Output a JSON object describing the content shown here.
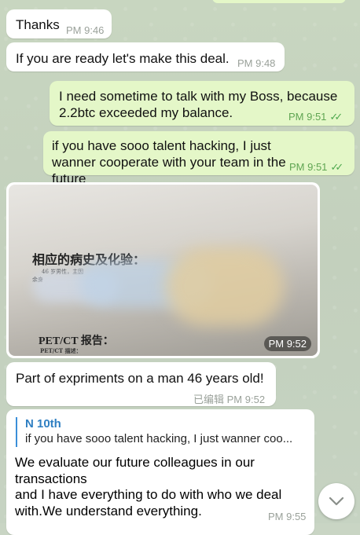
{
  "messages": {
    "m1": {
      "text": "Thanks",
      "time": "PM 9:46"
    },
    "m2": {
      "text": "If you are ready let's make this deal.",
      "time": "PM 9:48"
    },
    "m3": {
      "text": "I need sometime to talk with my Boss, because 2.2btc exceeded my balance.",
      "time": "PM 9:51",
      "status": "read"
    },
    "m4": {
      "text": "if you have sooo talent hacking, I just wanner cooperate with your team in the future",
      "time": "PM 9:51",
      "status": "read"
    },
    "photo": {
      "time": "PM 9:52",
      "heading": "相应的病史及化验：",
      "line1": "46 岁男性，主因",
      "line2": "余身",
      "subheading": "PET/CT 报告：",
      "sublabel": "PET/CT 描述："
    },
    "m5": {
      "text": "Part of expriments on a man 46 years old!",
      "edited": "已编辑",
      "time": "PM 9:52"
    },
    "m6": {
      "reply_name": "N 10th",
      "reply_text": "if you have sooo talent hacking, I just wanner coo...",
      "text_line1": "We evaluate our future colleagues in our",
      "text_line2": "transactions",
      "text_line3": "and I have everything to do with who we deal",
      "text_line4": "with.We understand everything.",
      "time": "PM 9:55"
    }
  },
  "colors": {
    "incoming": "#ffffff",
    "outgoing": "#e4f7c8",
    "read_ticks": "#4fa94f",
    "reply_accent": "#2f7fc2"
  }
}
